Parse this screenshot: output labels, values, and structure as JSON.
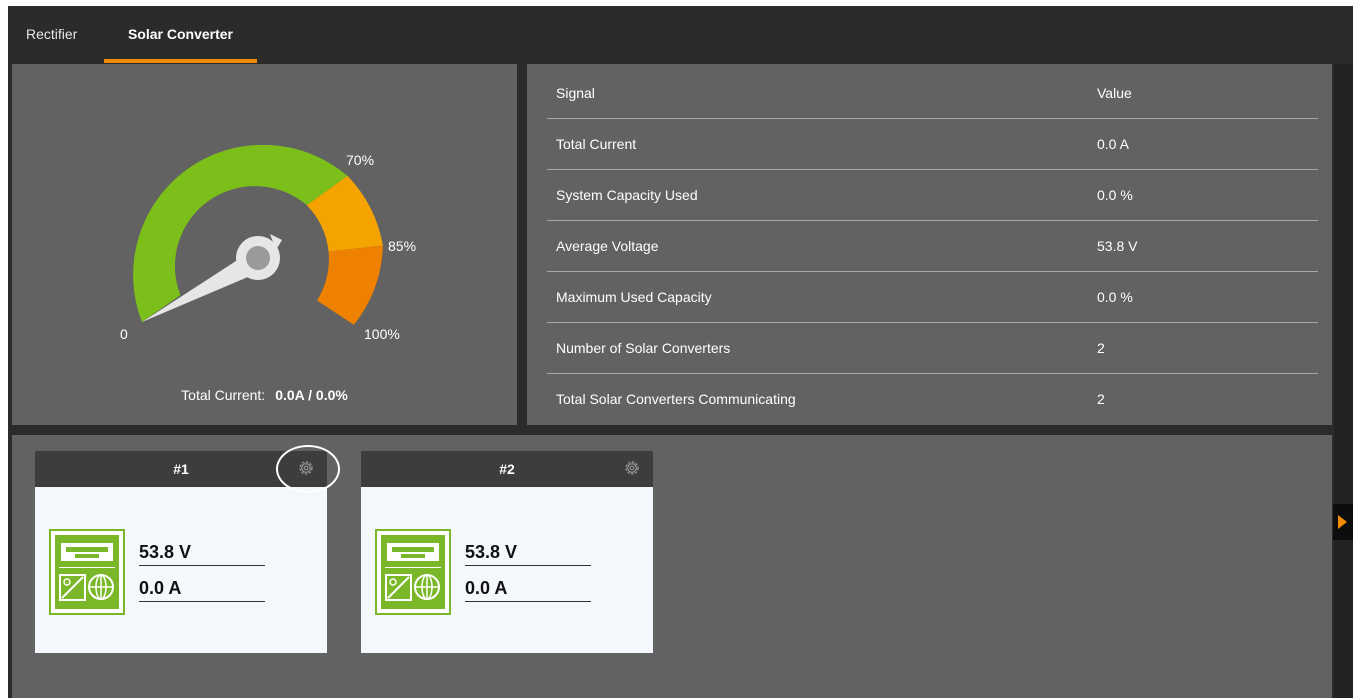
{
  "tabs": [
    {
      "label": "Rectifier",
      "active": false
    },
    {
      "label": "Solar Converter",
      "active": true
    }
  ],
  "gauge": {
    "labels": {
      "zero": "0",
      "p70": "70%",
      "p85": "85%",
      "p100": "100%"
    },
    "total_label": "Total Current:",
    "total_value": "0.0A / 0.0%",
    "needle_percent": 0,
    "colors": {
      "green": "#7cbf1a",
      "amber": "#f4a300",
      "orange": "#ee8100",
      "needle": "#e5e5e5"
    }
  },
  "table": {
    "headers": {
      "signal": "Signal",
      "value": "Value"
    },
    "rows": [
      {
        "signal": "Total Current",
        "value": "0.0 A"
      },
      {
        "signal": "System Capacity Used",
        "value": "0.0 %"
      },
      {
        "signal": "Average Voltage",
        "value": "53.8 V"
      },
      {
        "signal": "Maximum Used Capacity",
        "value": "0.0 %"
      },
      {
        "signal": "Number of Solar Converters",
        "value": "2"
      },
      {
        "signal": "Total Solar Converters Communicating",
        "value": "2"
      }
    ]
  },
  "converters": [
    {
      "title": "#1",
      "voltage": "53.8 V",
      "current": "0.0 A",
      "icon": "gear-icon"
    },
    {
      "title": "#2",
      "voltage": "53.8 V",
      "current": "0.0 A",
      "icon": "gear-icon"
    }
  ],
  "accent_color": "#f08c00",
  "device_color": "#7bb829"
}
